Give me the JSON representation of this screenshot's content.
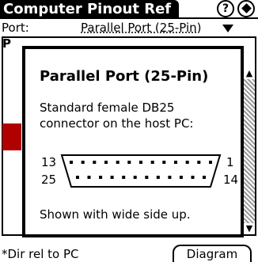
{
  "app": {
    "title": "Computer Pinout Ref",
    "help_label": "?",
    "menu_icon": "diamond-icon"
  },
  "port": {
    "label": "Port:",
    "value": "Parallel Port (25-Pin)"
  },
  "background": {
    "header_fragment": "P"
  },
  "dialog": {
    "title": "Parallel Port (25-Pin)",
    "description_lines": [
      "Standard female DB25",
      "connector on the host PC:"
    ],
    "pin_top_left": "13",
    "pin_top_right": "1",
    "pin_bottom_left": "25",
    "pin_bottom_right": "14",
    "top_row_pins": 13,
    "bottom_row_pins": 12,
    "footnote": "Shown with wide side up."
  },
  "footer": {
    "note": "*Dir rel to PC",
    "diagram_button": "Diagram"
  },
  "colors": {
    "accent_red": "#b00000",
    "ink": "#000000",
    "paper": "#ffffff"
  }
}
